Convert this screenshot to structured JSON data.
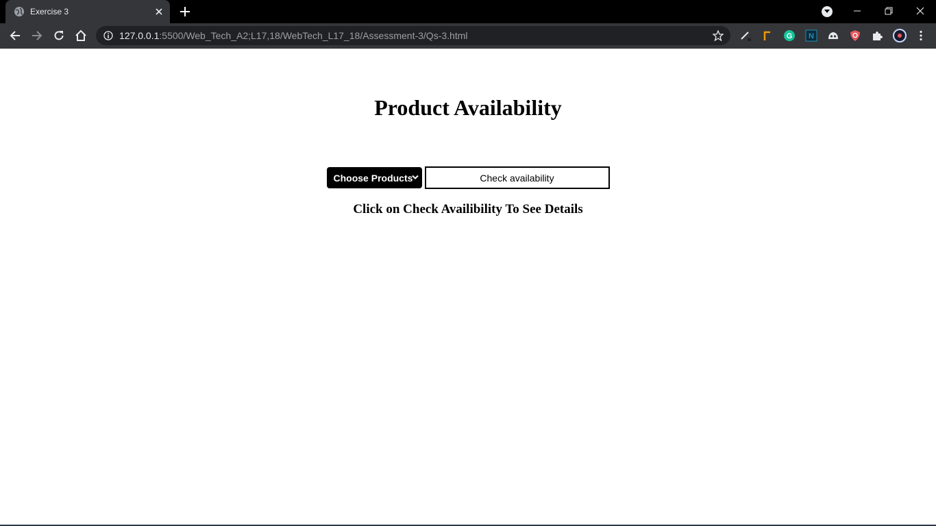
{
  "browser": {
    "tab": {
      "title": "Exercise 3",
      "favicon": "globe-icon",
      "close_icon": "close-icon"
    },
    "new_tab_icon": "plus-icon",
    "window_controls": [
      "minimize-icon",
      "restore-icon",
      "close-icon"
    ],
    "toolbar": {
      "nav": [
        "back-icon",
        "forward-icon",
        "reload-icon",
        "home-icon"
      ],
      "url_host": "127.0.0.1",
      "url_rest": ":5500/Web_Tech_A2;L17,18/WebTech_L17_18/Assessment-3/Qs-3.html",
      "extensions": [
        "pen-extension-icon",
        "flag-extension-icon",
        "grammarly-extension-icon",
        "notion-extension-icon",
        "ghost-extension-icon",
        "shield-extension-icon",
        "puzzle-extensions-icon",
        "profile-avatar-icon",
        "kebab-menu-icon"
      ]
    },
    "colors": {
      "tabstrip": "#000000",
      "toolbar": "#35363a",
      "omnibox": "#202124",
      "icon": "#e8eaed"
    }
  },
  "page": {
    "heading": "Product Availability",
    "select": {
      "selected": "Choose Products"
    },
    "check_button": "Check availability",
    "details_text": "Click on Check Availibility To See Details"
  }
}
